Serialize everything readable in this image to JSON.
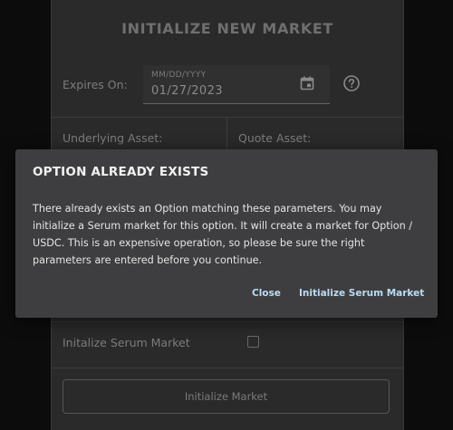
{
  "page": {
    "title": "INITIALIZE NEW MARKET"
  },
  "expires": {
    "label": "Expires On:",
    "placeholder": "MM/DD/YYYY",
    "value": "01/27/2023",
    "calendar_icon": "calendar-icon",
    "help_icon": "help-circle-icon"
  },
  "assets": {
    "underlying_label": "Underlying Asset:",
    "quote_label": "Quote Asset:"
  },
  "serum": {
    "label": "Initalize Serum Market",
    "checked": false
  },
  "actions": {
    "initialize_label": "Initialize Market"
  },
  "modal": {
    "title": "OPTION ALREADY EXISTS",
    "body": "There already exists an Option matching these parameters. You may initialize a Serum market for this option. It will create a market for Option / USDC. This is an expensive operation, so please be sure the right parameters are entered before you continue.",
    "close_label": "Close",
    "init_serum_label": "Initialize Serum Market"
  },
  "colors": {
    "background": "#0c0c0c",
    "panel": "#2a2a2a",
    "modal": "#3e3e40",
    "link": "#b9dcf3"
  }
}
